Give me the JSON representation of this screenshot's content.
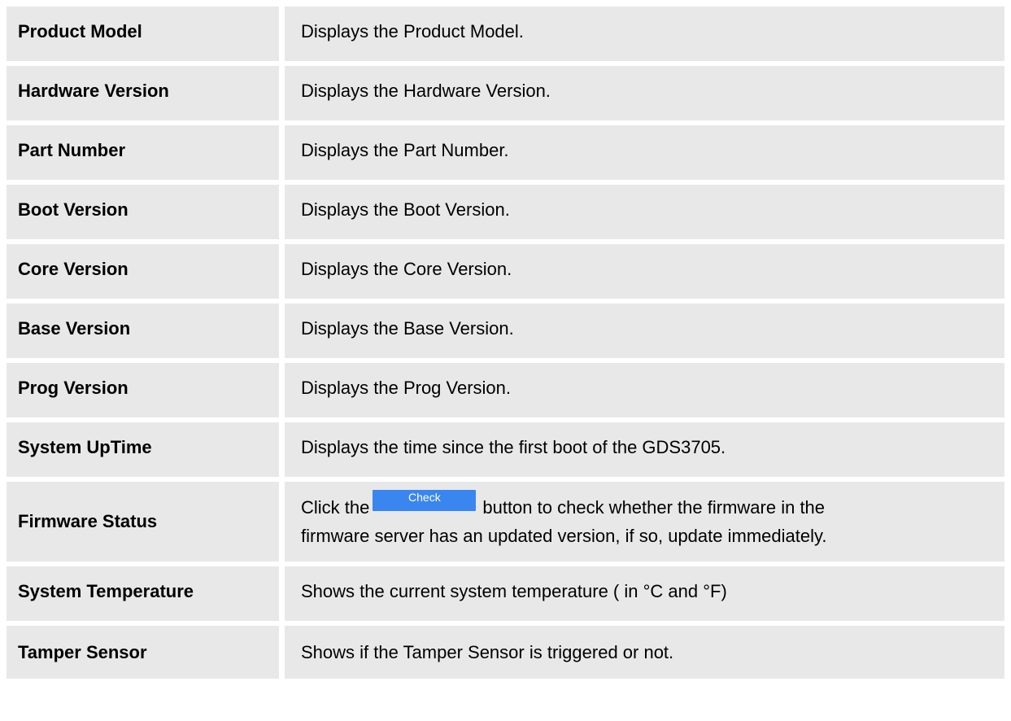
{
  "rows": [
    {
      "key": "Product Model",
      "desc": "Displays the Product Model."
    },
    {
      "key": "Hardware Version",
      "desc": "Displays the Hardware Version."
    },
    {
      "key": "Part Number",
      "desc": "Displays the Part Number."
    },
    {
      "key": "Boot Version",
      "desc": "Displays the Boot Version."
    },
    {
      "key": "Core Version",
      "desc": "Displays the Core Version."
    },
    {
      "key": "Base Version",
      "desc": "Displays the Base Version."
    },
    {
      "key": "Prog Version",
      "desc": "Displays the Prog Version."
    },
    {
      "key": "System UpTime",
      "desc": "Displays the time since the first boot of the GDS3705."
    },
    {
      "key": "Firmware Status",
      "desc_prefix": "Click the",
      "button_label": "Check",
      "desc_suffix_line1": "button to check whether the firmware in the",
      "desc_line2": "firmware server has an updated version, if so, update immediately."
    },
    {
      "key": "System Temperature",
      "desc": "Shows the current system temperature ( in °C and °F)"
    },
    {
      "key": "Tamper Sensor",
      "desc": "Shows if the Tamper Sensor is triggered or not."
    }
  ],
  "colors": {
    "row_background": "#e8e8e8",
    "button_background": "#3a86f0",
    "button_text": "#ffffff"
  }
}
